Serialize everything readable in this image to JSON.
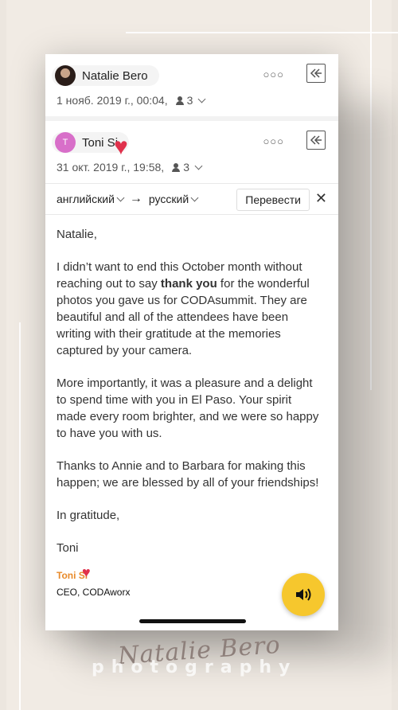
{
  "messages": [
    {
      "sender": "Natalie Bero",
      "date": "1 нояб. 2019 г., 00:04,",
      "recipients": "3"
    },
    {
      "sender": "Toni Si",
      "avatar_letter": "T",
      "date": "31 окт. 2019 г., 19:58,",
      "recipients": "3"
    }
  ],
  "translate": {
    "from": "английский",
    "to": "русский",
    "button": "Перевести",
    "close": "✕"
  },
  "email": {
    "greeting": "Natalie,",
    "p1_before": "I didn’t want to end this October month without reaching out to say ",
    "p1_bold": "thank you",
    "p1_after": " for the wonderful photos you gave us for CODAsummit.  They are beautiful and all of the attendees have been writing with their gratitude at the memories captured by your camera.",
    "p2": "More importantly, it was a pleasure and a delight to spend time with you in El Paso.  Your spirit made every room brighter, and we were so happy to have you with us.",
    "p3": "Thanks to Annie and to Barbara for making this happen; we are blessed by all of your friendships!",
    "closing": "In gratitude,",
    "name": "Toni",
    "sig_name": "Toni Si",
    "sig_title": "CEO, CODAworx"
  },
  "watermark": {
    "signature": "Natalie Bero",
    "subtitle": "photography"
  },
  "icons": {
    "more": "more-dots-icon",
    "reply": "reply-all-icon",
    "audio": "speaker-icon",
    "sticker": "heart-icon"
  },
  "colors": {
    "accent_yellow": "#f6c72d",
    "heart": "#e0314c",
    "signature_orange": "#e88a2a",
    "avatar_pink": "#d86fc9"
  }
}
